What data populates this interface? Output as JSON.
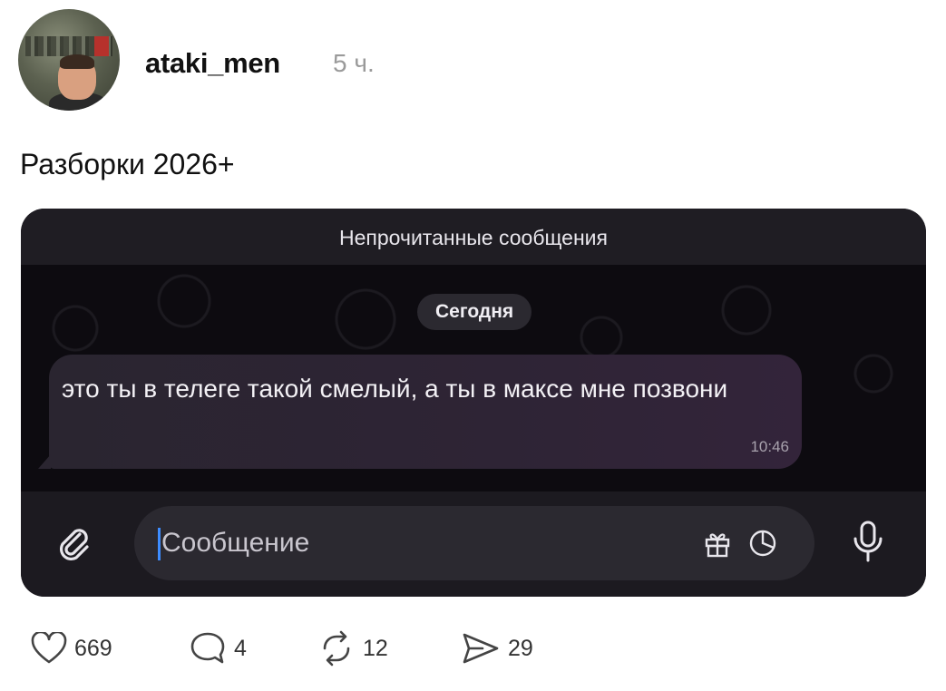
{
  "post": {
    "username": "ataki_men",
    "time_ago": "5 ч.",
    "text": "Разборки 2026+"
  },
  "chat": {
    "header": "Непрочитанные сообщения",
    "date_label": "Сегодня",
    "message": {
      "text": "это ты в телеге такой смелый, а ты в максе мне позвони",
      "time": "10:46"
    },
    "input_placeholder": "Сообщение",
    "icons": [
      "paperclip-icon",
      "gift-icon",
      "sticker-icon",
      "microphone-icon"
    ]
  },
  "actions": {
    "likes": "669",
    "comments": "4",
    "reposts": "12",
    "shares": "29"
  },
  "colors": {
    "chat_background": "#0c0a0e",
    "chat_header": "#1f1d23",
    "bubble": "#2e2435",
    "caret": "#3d8cff"
  }
}
